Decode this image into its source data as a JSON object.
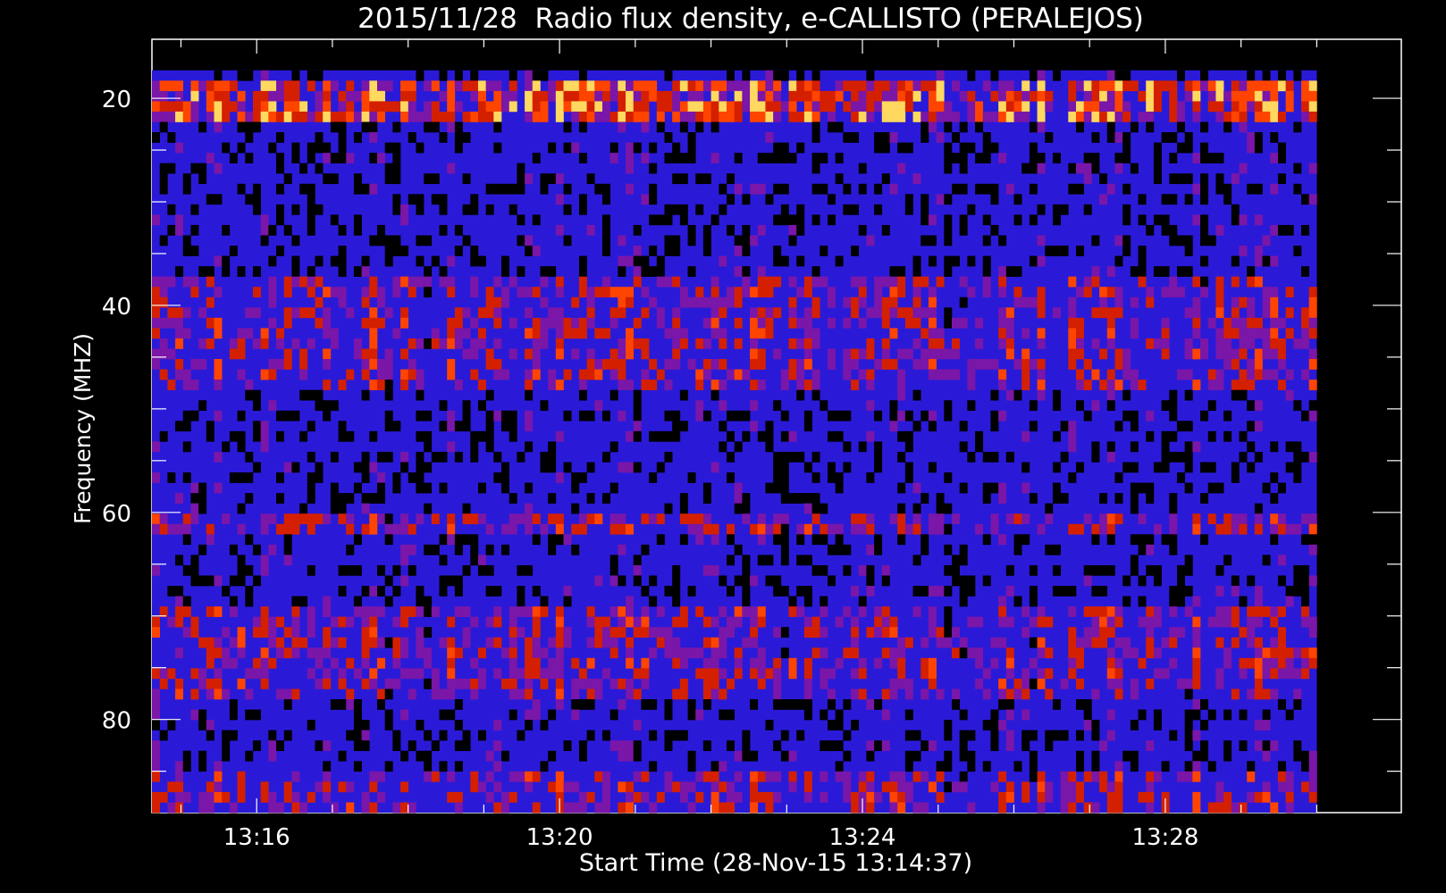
{
  "chart_data": {
    "type": "heatmap",
    "title": "2015/11/28  Radio flux density, e-CALLISTO (PERALEJOS)",
    "xlabel": "Start Time (28-Nov-15 13:14:37)",
    "ylabel": "Frequency (MHZ)",
    "x_start": "13:14:37",
    "x_end": "13:30:00",
    "xlim": [
      "13:14:37",
      "13:31:07"
    ],
    "ylim": [
      89,
      14.3
    ],
    "y_data_range": [
      17.3,
      89
    ],
    "x_ticks": [
      "13:16",
      "13:20",
      "13:24",
      "13:28"
    ],
    "x_tick_values_min": [
      16,
      20,
      24,
      28
    ],
    "y_ticks": [
      20,
      40,
      60,
      80
    ],
    "y_minor_step": 5,
    "x_minor_step_min": 1,
    "colormap": [
      "#000000",
      "#1410c8",
      "#3020ff",
      "#7a16a8",
      "#d42000",
      "#ff4400",
      "#ffd860"
    ],
    "bright_bands_mhz": [
      {
        "range": [
          18.5,
          22.5
        ],
        "intensity": "high"
      },
      {
        "range": [
          37,
          48
        ],
        "intensity": "medium"
      },
      {
        "range": [
          60,
          62
        ],
        "intensity": "medium"
      },
      {
        "range": [
          69.5,
          78
        ],
        "intensity": "medium"
      },
      {
        "range": [
          85,
          89
        ],
        "intensity": "medium"
      }
    ],
    "grid": false,
    "legend": "none"
  }
}
